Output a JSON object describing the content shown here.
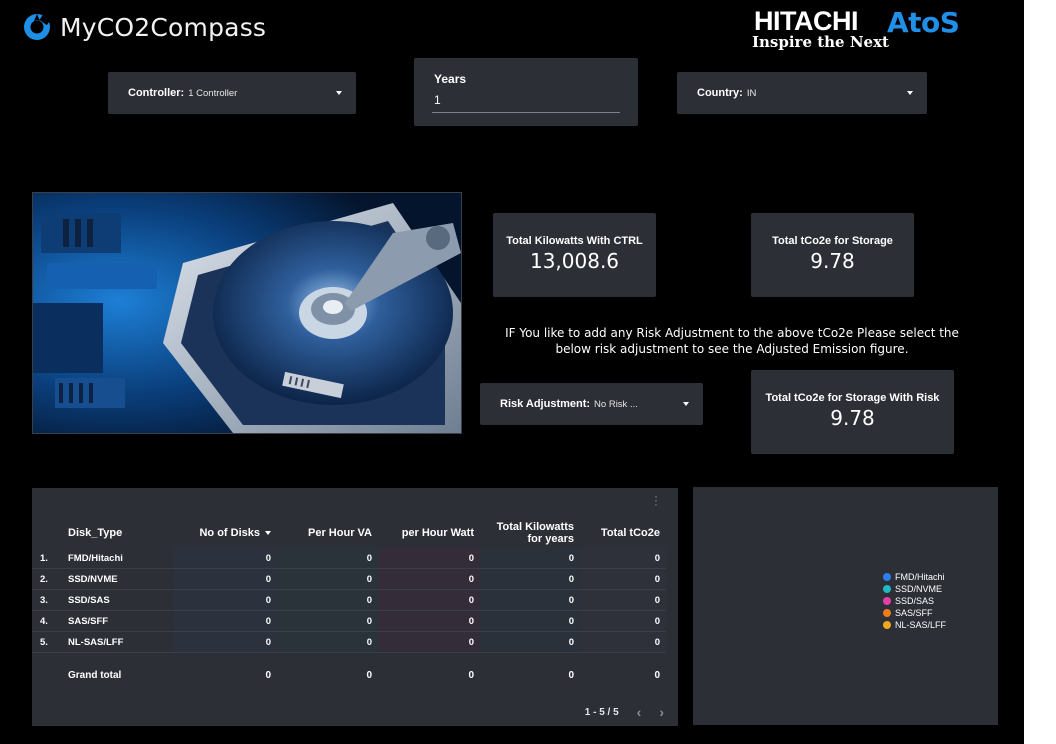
{
  "app": {
    "title": "MyCO2Compass"
  },
  "brand": {
    "hitachi": "HITACHI",
    "tagline": "Inspire the Next",
    "atos": "AtoS"
  },
  "filters": {
    "controller": {
      "label": "Controller:",
      "value": "1 Controller"
    },
    "years": {
      "label": "Years",
      "value": "1"
    },
    "country": {
      "label": "Country:",
      "value": "IN"
    },
    "risk": {
      "label": "Risk Adjustment:",
      "value": "No Risk ..."
    }
  },
  "kpis": {
    "total_kw": {
      "label": "Total Kilowatts With CTRL",
      "value": "13,008.6"
    },
    "total_tco2e": {
      "label": "Total tCo2e for Storage",
      "value": "9.78"
    },
    "total_tco2e_risk": {
      "label": "Total tCo2e for Storage With Risk",
      "value": "9.78"
    }
  },
  "risk_note": "IF You like to add any Risk Adjustment to the above tCo2e Please select the below risk adjustment to see the Adjusted Emission figure.",
  "table": {
    "headers": [
      "Disk_Type",
      "No of Disks",
      "Per Hour VA",
      "per Hour Watt",
      "Total Kilowatts for years",
      "Total tCo2e"
    ],
    "rows": [
      {
        "idx": "1.",
        "type": "FMD/Hitachi",
        "values": [
          "0",
          "0",
          "0",
          "0",
          "0"
        ]
      },
      {
        "idx": "2.",
        "type": "SSD/NVME",
        "values": [
          "0",
          "0",
          "0",
          "0",
          "0"
        ]
      },
      {
        "idx": "3.",
        "type": "SSD/SAS",
        "values": [
          "0",
          "0",
          "0",
          "0",
          "0"
        ]
      },
      {
        "idx": "4.",
        "type": "SAS/SFF",
        "values": [
          "0",
          "0",
          "0",
          "0",
          "0"
        ]
      },
      {
        "idx": "5.",
        "type": "NL-SAS/LFF",
        "values": [
          "0",
          "0",
          "0",
          "0",
          "0"
        ]
      }
    ],
    "grand_total": {
      "label": "Grand total",
      "values": [
        "0",
        "0",
        "0",
        "0",
        "0"
      ]
    },
    "pagination": "1 - 5 / 5"
  },
  "legend": [
    {
      "label": "FMD/Hitachi",
      "color": "#2e7df0"
    },
    {
      "label": "SSD/NVME",
      "color": "#20b8c2"
    },
    {
      "label": "SSD/SAS",
      "color": "#e43fa8"
    },
    {
      "label": "SAS/SFF",
      "color": "#f07a1e"
    },
    {
      "label": "NL-SAS/LFF",
      "color": "#f0a81e"
    }
  ],
  "colors": {
    "background": "#000000",
    "card": "#2c2f36",
    "atos_blue": "#1f8fe8"
  },
  "icons": {
    "logo": "compass-logo-icon",
    "dropdown": "caret-down-icon",
    "menu": "more-vert-icon"
  }
}
